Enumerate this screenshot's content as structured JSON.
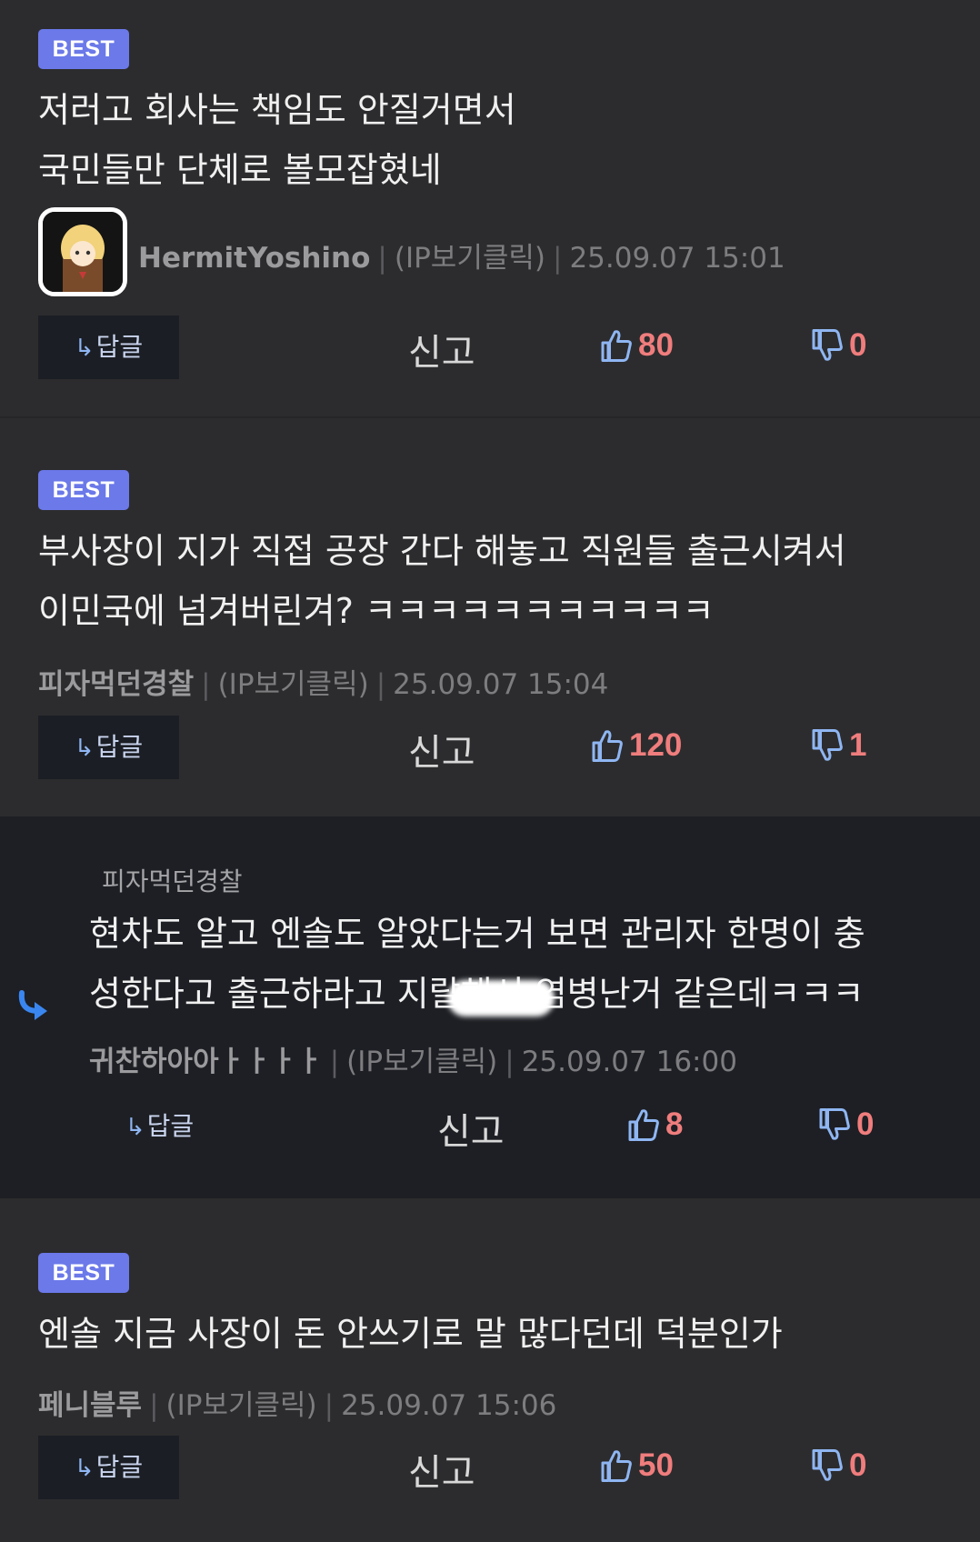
{
  "actions": {
    "reply_label": "답글",
    "report_label": "신고"
  },
  "comments": [
    {
      "badge": "BEST",
      "lines": [
        "저러고 회사는 책임도 안질거면서",
        "국민들만 단체로 볼모잡혔네"
      ],
      "nickname": "HermitYoshino",
      "ip": "(IP보기클릭)",
      "timestamp": "25.09.07 15:01",
      "likes": "80",
      "dislikes": "0"
    },
    {
      "badge": "BEST",
      "lines": [
        "부사장이 지가 직접 공장 간다 해놓고 직원들 출근시켜서",
        "이민국에 넘겨버린겨? ㅋㅋㅋㅋㅋㅋㅋㅋㅋㅋㅋ"
      ],
      "nickname": "피자먹던경찰",
      "ip": "(IP보기클릭)",
      "timestamp": "25.09.07 15:04",
      "likes": "120",
      "dislikes": "1"
    },
    {
      "reply_to": "피자먹던경찰",
      "lines": [
        "현차도 알고 엔솔도 알았다는거 보면 관리자 한명이 충",
        "성한다고 출근하라고 지랄해서 염병난거 같은데ㅋㅋㅋ"
      ],
      "nickname": "귀찬하아아ㅏㅏㅏㅏ",
      "ip": "(IP보기클릭)",
      "timestamp": "25.09.07 16:00",
      "likes": "8",
      "dislikes": "0"
    },
    {
      "badge": "BEST",
      "lines": [
        "엔솔 지금 사장이 돈 안쓰기로 말 많다던데 덕분인가"
      ],
      "nickname": "페니블루",
      "ip": "(IP보기클릭)",
      "timestamp": "25.09.07 15:06",
      "likes": "50",
      "dislikes": "0"
    }
  ],
  "colors": {
    "background": "#2c2c2e",
    "reply_background": "#1d1f24",
    "best_badge": "#6b79e9",
    "vote_count": "#f07d7d",
    "thumb_icon": "#8fb6f2"
  }
}
